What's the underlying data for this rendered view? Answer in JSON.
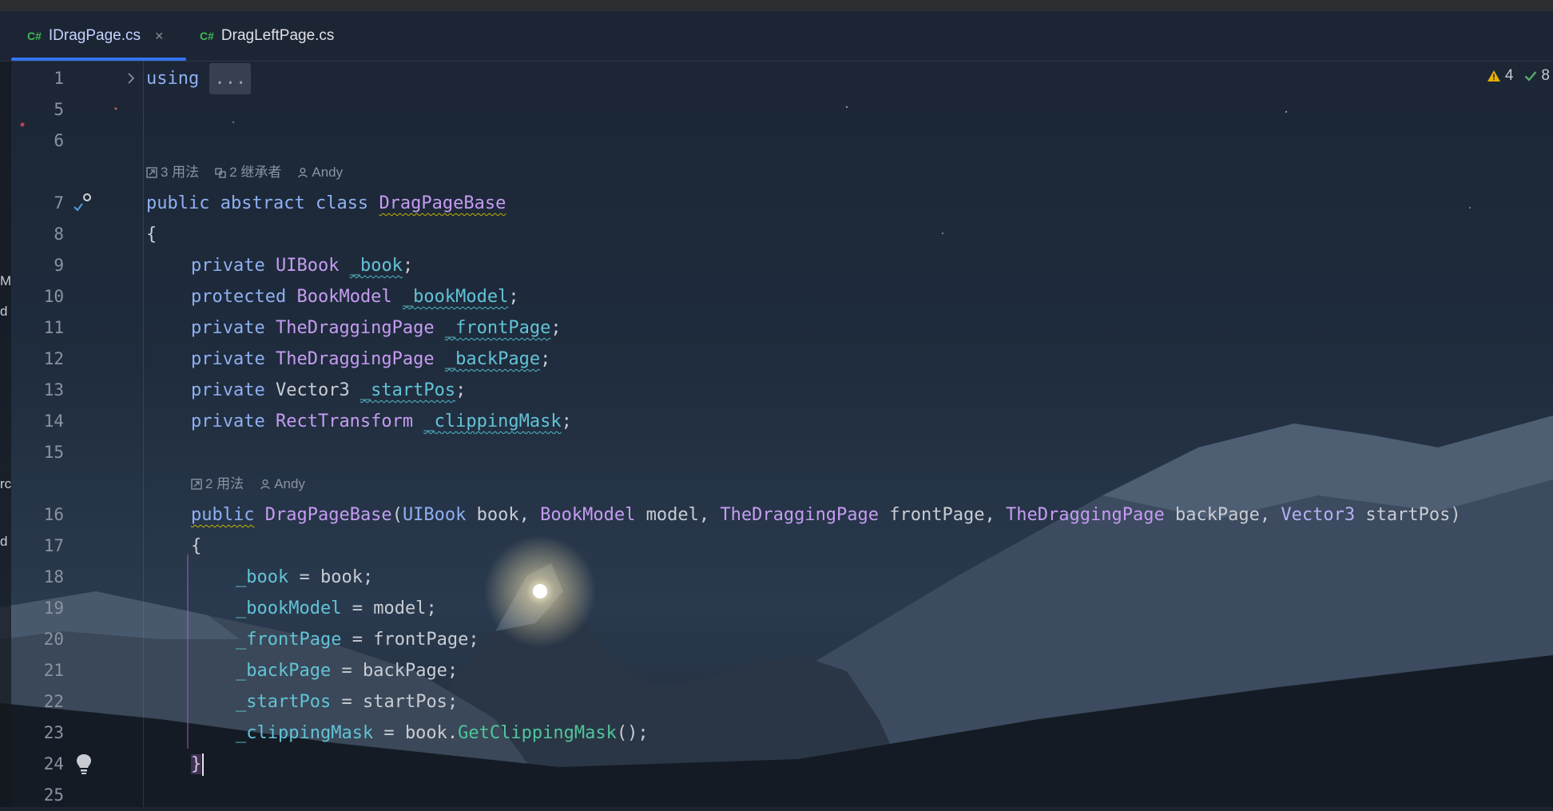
{
  "tabs": [
    {
      "lang": "C#",
      "label": "IDragPage.cs",
      "active": true,
      "close": "×"
    },
    {
      "lang": "C#",
      "label": "DragLeftPage.cs",
      "active": false
    }
  ],
  "status": {
    "warnings": "4",
    "checks": "8"
  },
  "left_edge_chars": [
    "M",
    "d",
    "rc",
    "d"
  ],
  "hints": {
    "class_usages": "3 用法",
    "class_inheritors": "2 继承者",
    "class_author": "Andy",
    "ctor_usages": "2 用法",
    "ctor_author": "Andy"
  },
  "line_numbers": [
    "1",
    "5",
    "6",
    "7",
    "8",
    "9",
    "10",
    "11",
    "12",
    "13",
    "14",
    "15",
    "16",
    "17",
    "18",
    "19",
    "20",
    "21",
    "22",
    "23",
    "24",
    "25"
  ],
  "code": {
    "l1_kw": "using",
    "l1_fold": "...",
    "l7_public": "public",
    "l7_abstract": "abstract",
    "l7_class": "class",
    "l7_name": "DragPageBase",
    "brace_open": "{",
    "brace_close": "}",
    "l9_mod": "private",
    "l9_type": "UIBook",
    "l9_name": "_book",
    "l10_mod": "protected",
    "l10_type": "BookModel",
    "l10_name": "_bookModel",
    "l11_mod": "private",
    "l11_type": "TheDraggingPage",
    "l11_name": "_frontPage",
    "l12_mod": "private",
    "l12_type": "TheDraggingPage",
    "l12_name": "_backPage",
    "l13_mod": "private",
    "l13_type": "Vector3",
    "l13_name": "_startPos",
    "l14_mod": "private",
    "l14_type": "RectTransform",
    "l14_name": "_clippingMask",
    "l16_public": "public",
    "l16_name": "DragPageBase",
    "l16_t1": "UIBook",
    "l16_p1": "book",
    "l16_t2": "BookModel",
    "l16_p2": "model",
    "l16_t3": "TheDraggingPage",
    "l16_p3": "frontPage",
    "l16_t4": "TheDraggingPage",
    "l16_p4": "backPage",
    "l16_t5": "Vector3",
    "l16_p5": "startPos",
    "l18_f": "_book",
    "l18_v": "book",
    "l19_f": "_bookModel",
    "l19_v": "model",
    "l20_f": "_frontPage",
    "l20_v": "frontPage",
    "l21_f": "_backPage",
    "l21_v": "backPage",
    "l22_f": "_startPos",
    "l22_v": "startPos",
    "l23_f": "_clippingMask",
    "l23_obj": "book",
    "l23_m": "GetClippingMask"
  },
  "colors": {
    "keyword": "#8fb0f2",
    "type": "#c59cf1",
    "field": "#62c3d6",
    "method": "#50c69a",
    "tab_accent": "#3574f0",
    "csharp_badge": "#3fb950",
    "warning": "#e5b000",
    "ok": "#59a869"
  }
}
